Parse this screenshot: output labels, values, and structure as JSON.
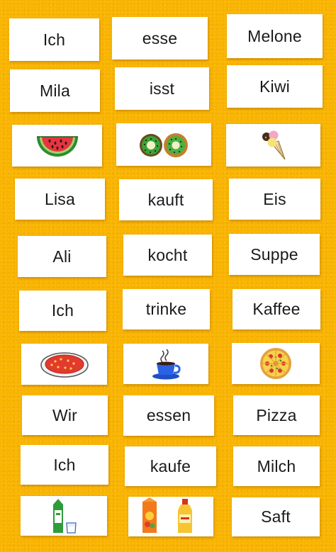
{
  "rows": [
    {
      "subject": "Ich",
      "verb": "esse",
      "object": "Melone"
    },
    {
      "subject": "Mila",
      "verb": "isst",
      "object": "Kiwi"
    },
    {
      "subject": "Lisa",
      "verb": "kauft",
      "object": "Eis"
    },
    {
      "subject": "Ali",
      "verb": "kocht",
      "object": "Suppe"
    },
    {
      "subject": "Ich",
      "verb": "trinke",
      "object": "Kaffee"
    },
    {
      "subject": "Wir",
      "verb": "essen",
      "object": "Pizza"
    },
    {
      "subject": "Ich",
      "verb": "kaufe",
      "object": "Milch"
    }
  ],
  "last_object": "Saft",
  "picture_cards": [
    "watermelon-icon",
    "kiwi-icon",
    "ice-cream-icon",
    "soup-icon",
    "coffee-cup-icon",
    "pizza-icon",
    "milk-icon",
    "juice-icon"
  ],
  "colors": {
    "felt": "#f9b400",
    "card": "#ffffff",
    "text": "#1a1a1a"
  }
}
